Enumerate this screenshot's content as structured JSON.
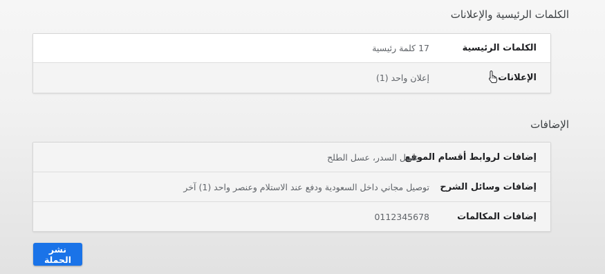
{
  "keywords_section": {
    "title": "الكلمات الرئيسية والإعلانات",
    "rows": [
      {
        "label": "الكلمات الرئيسية",
        "value": "17 كلمة رئيسية"
      },
      {
        "label": "الإعلانات",
        "value": "إعلان واحد (1)"
      }
    ]
  },
  "extensions_section": {
    "title": "الإضافات",
    "rows": [
      {
        "label": "إضافات لروابط أقسام الموقع",
        "value": "عسل السدر، عسل الطلح"
      },
      {
        "label": "إضافات وسائل الشرح",
        "value": "توصيل مجاني داخل السعودية ودفع عند الاستلام وعنصر واحد (1) آخر"
      },
      {
        "label": "إضافات المكالمات",
        "value": "0112345678"
      }
    ]
  },
  "actions": {
    "publish_label": "نشر الحملة"
  },
  "colors": {
    "primary_button": "#1a73e8"
  },
  "icons": {
    "cursor": "hand-pointer-icon"
  }
}
